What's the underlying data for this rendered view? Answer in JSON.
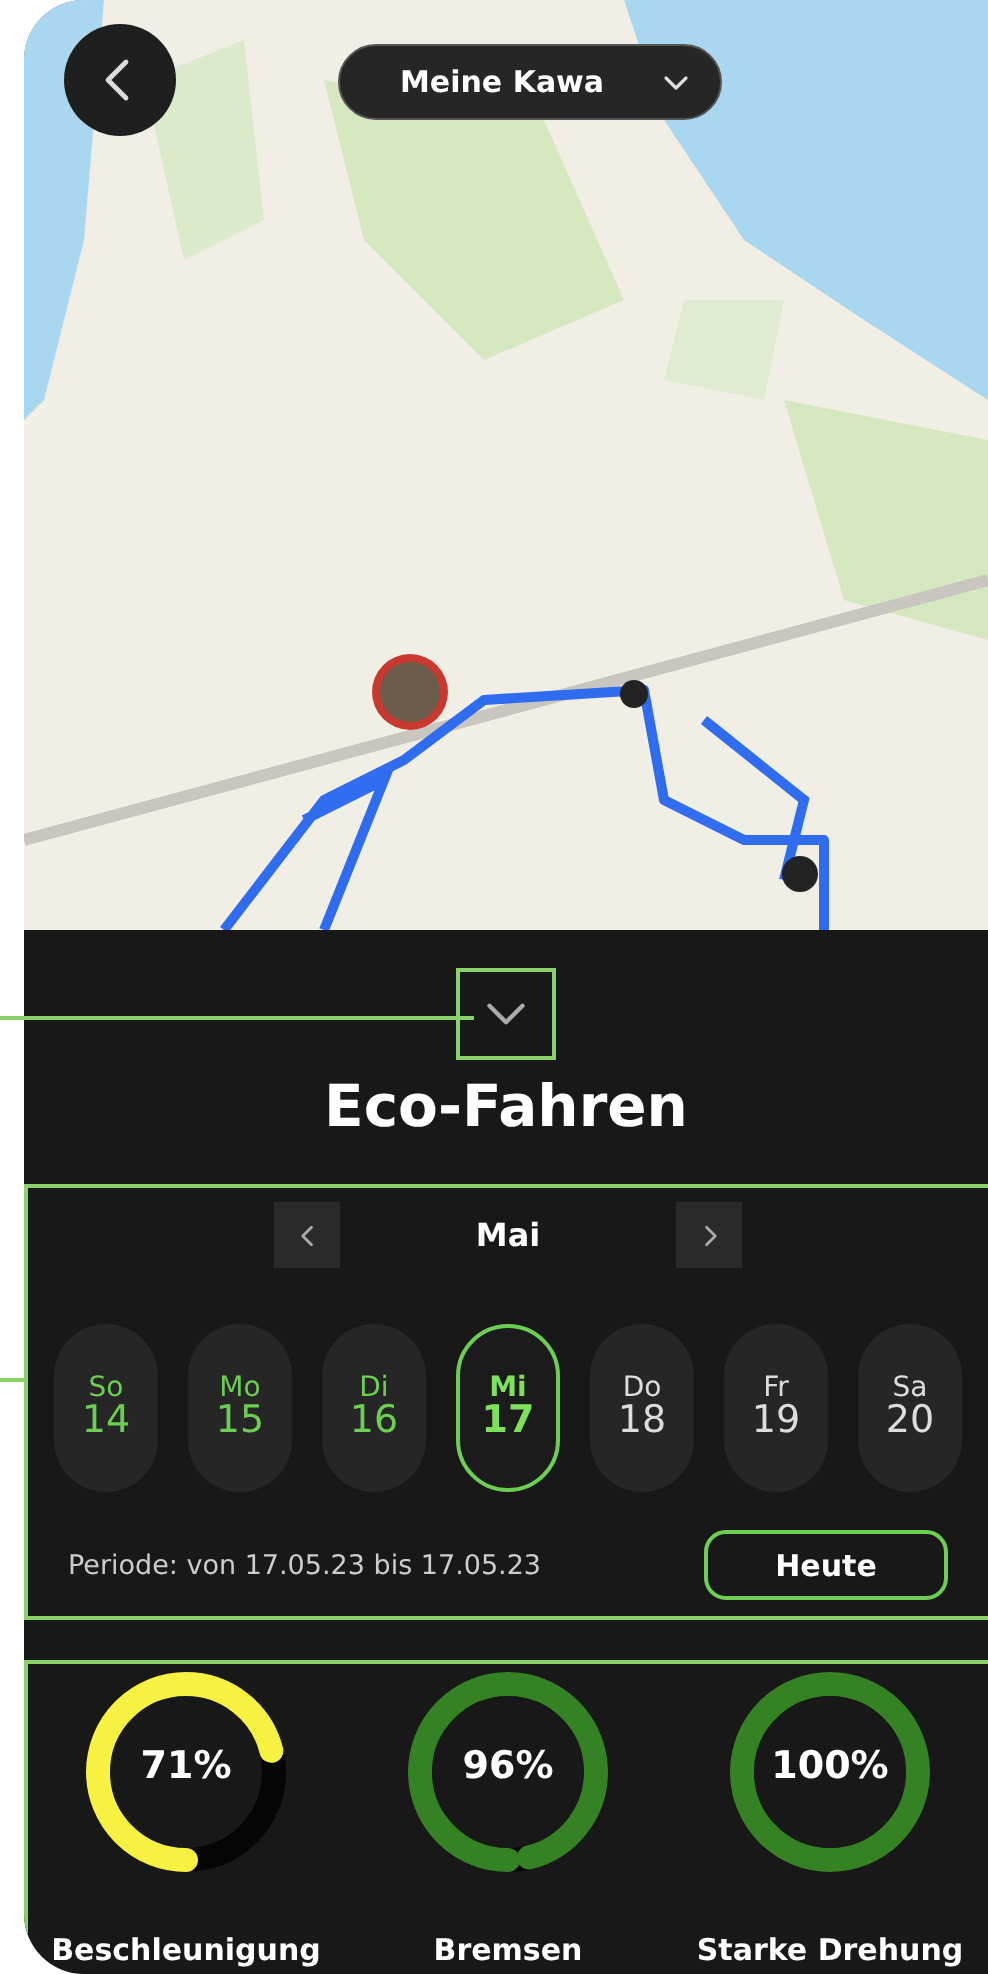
{
  "vehicle_selector": {
    "label": "Meine Kawa"
  },
  "title": "Eco-Fahren",
  "calendar": {
    "month": "Mai",
    "days": [
      {
        "weekday": "So",
        "date": "14",
        "recorded": true,
        "selected": false
      },
      {
        "weekday": "Mo",
        "date": "15",
        "recorded": true,
        "selected": false
      },
      {
        "weekday": "Di",
        "date": "16",
        "recorded": true,
        "selected": false
      },
      {
        "weekday": "Mi",
        "date": "17",
        "recorded": true,
        "selected": true
      },
      {
        "weekday": "Do",
        "date": "18",
        "recorded": false,
        "selected": false
      },
      {
        "weekday": "Fr",
        "date": "19",
        "recorded": false,
        "selected": false
      },
      {
        "weekday": "Sa",
        "date": "20",
        "recorded": false,
        "selected": false
      }
    ],
    "period": "Periode: von 17.05.23 bis 17.05.23",
    "today_button": "Heute"
  },
  "metrics": [
    {
      "label": "Beschleunigung",
      "reading": "71%",
      "level": 0.71,
      "color": "#f7f241"
    },
    {
      "label": "Bremsen",
      "reading": "96%",
      "level": 0.96,
      "color": "#358224"
    },
    {
      "label": "Starke Drehung",
      "reading": "100%",
      "level": 1,
      "color": "#358224"
    }
  ]
}
